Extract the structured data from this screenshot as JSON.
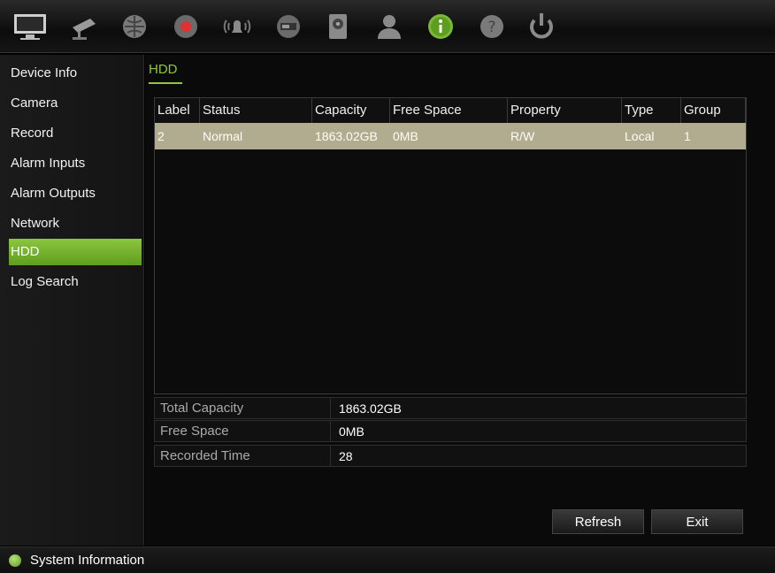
{
  "toolbar": {
    "icons": [
      "monitor-icon",
      "camera-icon",
      "network-icon",
      "record-icon",
      "alarm-icon",
      "device-icon",
      "hdd-icon",
      "user-icon",
      "info-icon",
      "help-icon",
      "power-icon"
    ]
  },
  "sidebar": {
    "items": [
      {
        "label": "Device Info"
      },
      {
        "label": "Camera"
      },
      {
        "label": "Record"
      },
      {
        "label": "Alarm Inputs"
      },
      {
        "label": "Alarm Outputs"
      },
      {
        "label": "Network"
      },
      {
        "label": "HDD",
        "active": true
      },
      {
        "label": "Log Search"
      }
    ]
  },
  "main": {
    "tab": "HDD",
    "table": {
      "headers": [
        "Label",
        "Status",
        "Capacity",
        "Free Space",
        "Property",
        "Type",
        "Group"
      ],
      "rows": [
        [
          "2",
          "Normal",
          "1863.02GB",
          "0MB",
          "R/W",
          "Local",
          "1"
        ]
      ]
    },
    "summary": {
      "total_capacity_label": "Total Capacity",
      "total_capacity_value": "1863.02GB",
      "free_space_label": "Free Space",
      "free_space_value": "0MB",
      "recorded_time_label": "Recorded Time",
      "recorded_time_value": "28"
    },
    "buttons": {
      "refresh": "Refresh",
      "exit": "Exit"
    }
  },
  "statusbar": {
    "text": "System Information"
  },
  "colors": {
    "accent": "#8cc63f",
    "selected_row": "#b1ac90"
  }
}
